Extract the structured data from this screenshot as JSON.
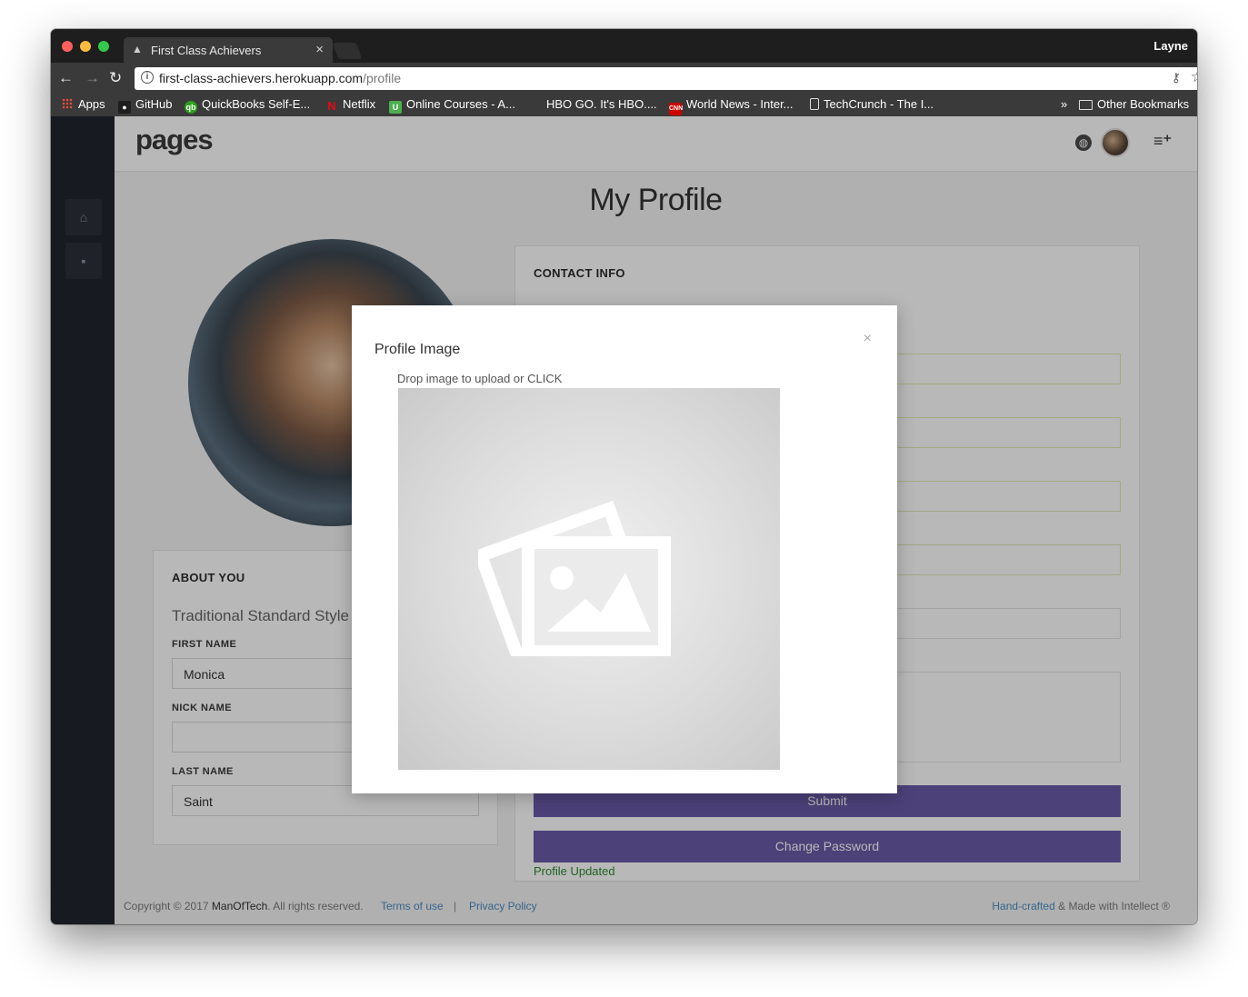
{
  "browser": {
    "tab_title": "First Class Achievers",
    "tab_close": "×",
    "profile_name": "Layne",
    "url_host": "first-class-achievers.herokuapp.com",
    "url_path": "/profile",
    "bookmarks": [
      {
        "label": "Apps",
        "icon": "apps-grid-icon"
      },
      {
        "label": "GitHub",
        "icon": "github-icon"
      },
      {
        "label": "QuickBooks Self-E...",
        "icon": "quickbooks-icon"
      },
      {
        "label": "Netflix",
        "icon": "netflix-icon"
      },
      {
        "label": "Online Courses - A...",
        "icon": "udemy-icon"
      },
      {
        "label": "HBO GO. It's HBO....",
        "icon": "hbo-icon"
      },
      {
        "label": "World News - Inter...",
        "icon": "cnn-icon"
      },
      {
        "label": "TechCrunch - The I...",
        "icon": "document-icon"
      }
    ],
    "bookmarks_overflow": "»",
    "other_bookmarks": "Other Bookmarks"
  },
  "app": {
    "brand": "pages",
    "page_title": "My Profile"
  },
  "about": {
    "heading": "ABOUT YOU",
    "subtitle": "Traditional Standard Style",
    "first_name_label": "FIRST NAME",
    "first_name_value": "Monica",
    "nick_name_label": "NICK NAME",
    "nick_name_value": "",
    "last_name_label": "LAST NAME",
    "last_name_value": "Saint"
  },
  "contact": {
    "heading": "CONTACT INFO",
    "submit_label": "Submit",
    "change_password_label": "Change Password",
    "status": "Profile Updated"
  },
  "footer": {
    "copyright_prefix": "Copyright © 2017 ",
    "company": "ManOfTech",
    "copyright_suffix": ". All rights reserved.",
    "terms": "Terms of use",
    "separator": "|",
    "privacy": "Privacy Policy",
    "handcrafted": "Hand-crafted",
    "made_with": " & Made with Intellect ®"
  },
  "modal": {
    "title": "Profile Image",
    "close": "×",
    "drop_hint": "Drop image to upload or CLICK",
    "placeholder_icon": "image-placeholder-icon"
  },
  "colors": {
    "accent_purple": "#6a5aa8",
    "success_green": "#2b8a2b",
    "link_blue": "#4a8cc4",
    "sidebar_dark": "#21252d"
  }
}
